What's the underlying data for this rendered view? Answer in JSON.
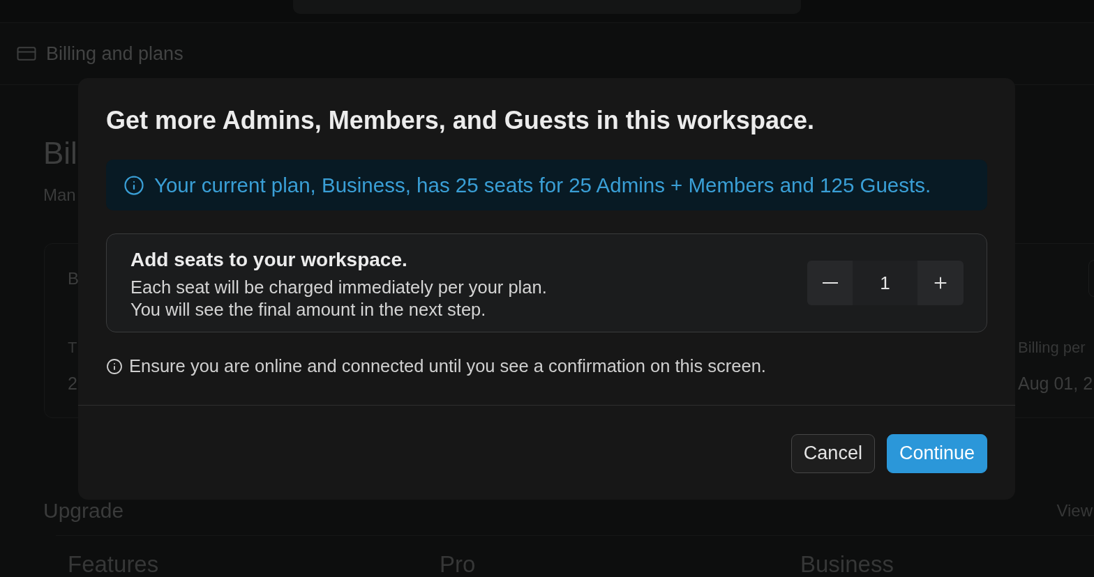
{
  "breadcrumb": {
    "label": "Billing and plans"
  },
  "page": {
    "title": "Bil",
    "subtitle": "Man",
    "summary_card": {
      "heading": "B",
      "stats": [
        {
          "label": "T",
          "value": "2"
        },
        {
          "label": "Billing per",
          "value": "Aug 01, 2"
        }
      ]
    },
    "upgrade": {
      "heading": "Upgrade",
      "link": "View",
      "table": {
        "columns": [
          "Features",
          "Pro",
          "Business"
        ]
      }
    }
  },
  "dialog": {
    "title": "Get more Admins, Members, and Guests in this workspace.",
    "notice": "Your current plan, Business, has 25 seats for 25 Admins + Members and 125 Guests.",
    "seats": {
      "heading": "Add seats to your workspace.",
      "lines": [
        "Each seat will be charged immediately per your plan.",
        "You will see the final amount in the next step."
      ],
      "quantity": "1"
    },
    "note": "Ensure you are online and connected until you see a confirmation on this screen.",
    "buttons": [
      {
        "label": "Cancel",
        "kind": "secondary"
      },
      {
        "label": "Continue",
        "kind": "primary"
      }
    ]
  }
}
